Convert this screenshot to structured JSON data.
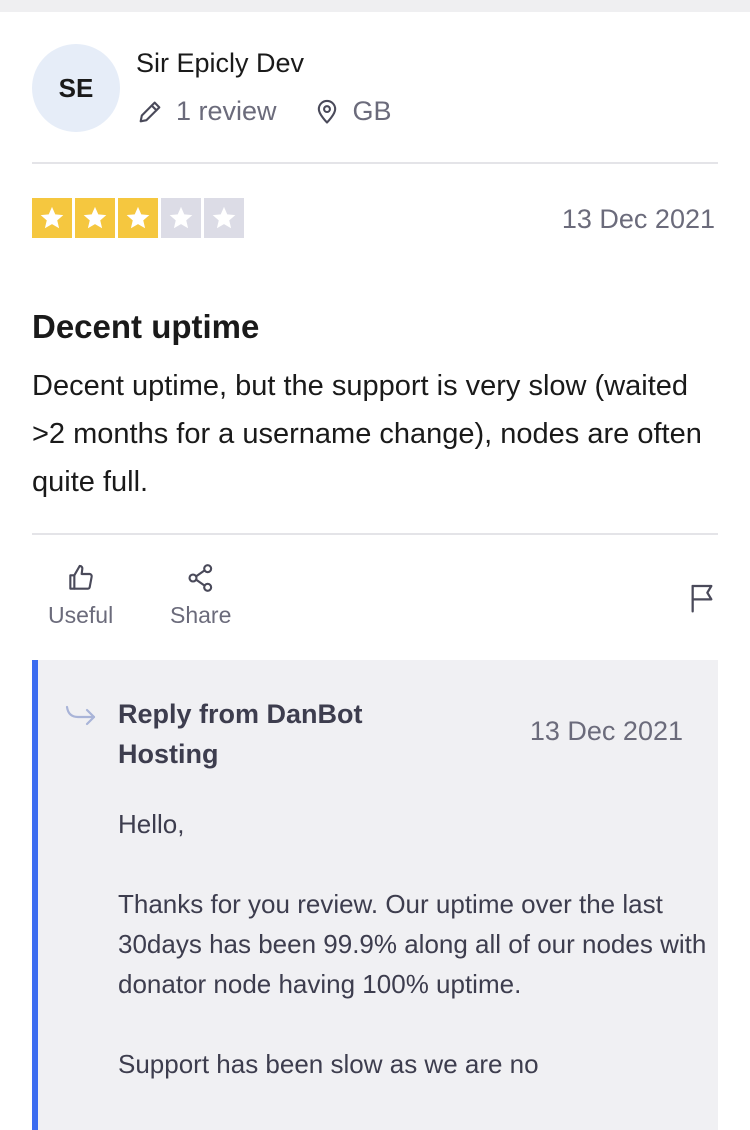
{
  "reviewer": {
    "initials": "SE",
    "name": "Sir Epicly Dev",
    "review_count": "1 review",
    "country": "GB"
  },
  "review": {
    "rating": 3,
    "rating_max": 5,
    "date": "13 Dec 2021",
    "title": "Decent uptime",
    "body": "Decent uptime, but the support is very slow (waited >2 months for a username change), nodes are often quite full."
  },
  "actions": {
    "useful_label": "Useful",
    "share_label": "Share"
  },
  "reply": {
    "from": "Reply from DanBot Hosting",
    "date": "13 Dec 2021",
    "paragraphs": [
      "Hello,",
      "Thanks for you review. Our uptime over the last 30days has been 99.9% along all of our nodes with donator node having 100% uptime.",
      "Support has been slow as we are no"
    ]
  },
  "colors": {
    "star_on": "#f5c73f",
    "star_off": "#dcdce6",
    "reply_accent": "#3c6cf0",
    "avatar_bg": "#e6edf8"
  },
  "icons": [
    "pencil-icon",
    "location-pin-icon",
    "star-icon",
    "thumbs-up-icon",
    "share-icon",
    "flag-icon",
    "reply-arrow-icon"
  ]
}
